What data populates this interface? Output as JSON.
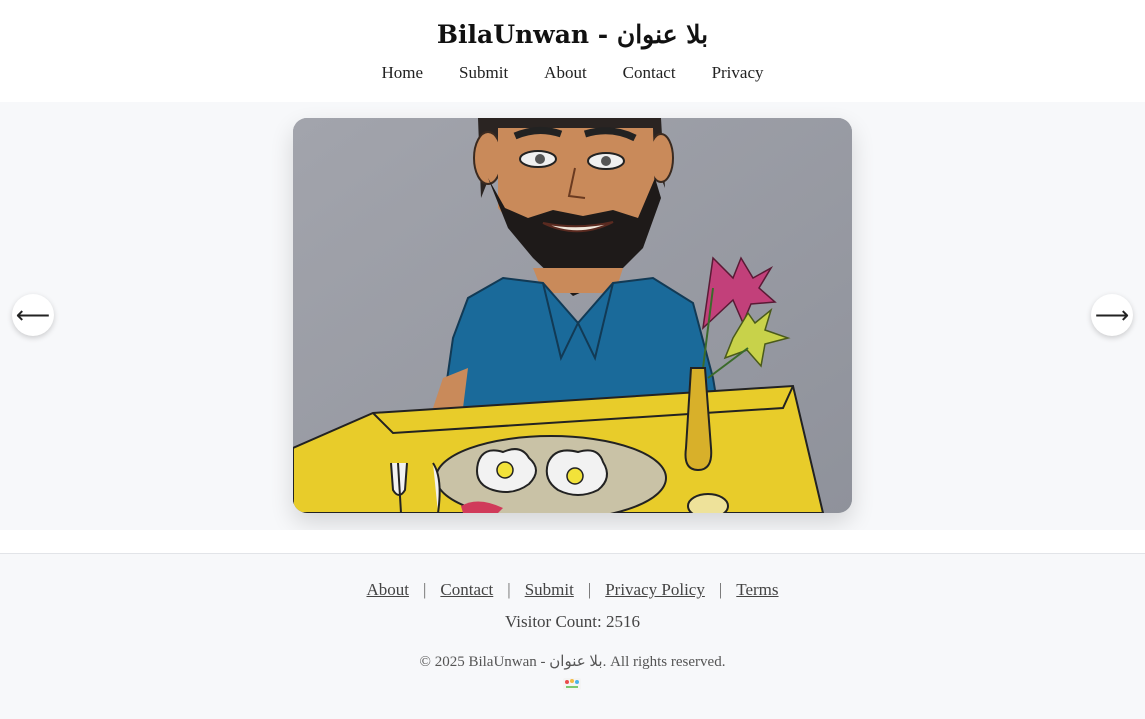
{
  "site": {
    "title": "BilaUnwan - بلا عنوان"
  },
  "nav": {
    "items": [
      "Home",
      "Submit",
      "About",
      "Contact",
      "Privacy"
    ]
  },
  "carousel": {
    "prev_label": "⟵",
    "next_label": "⟶",
    "image_alt": "Drawing of a bearded man at a table with breakfast and flowers"
  },
  "footer": {
    "links": [
      "About",
      "Contact",
      "Submit",
      "Privacy Policy",
      "Terms"
    ],
    "separator": "|",
    "visitor_count": "Visitor Count: 2516",
    "copyright": "© 2025 BilaUnwan - بلا عنوان. All rights reserved."
  },
  "colors": {
    "page_bg": "#f7f8fa",
    "header_bg": "#ffffff",
    "text": "#222222"
  }
}
